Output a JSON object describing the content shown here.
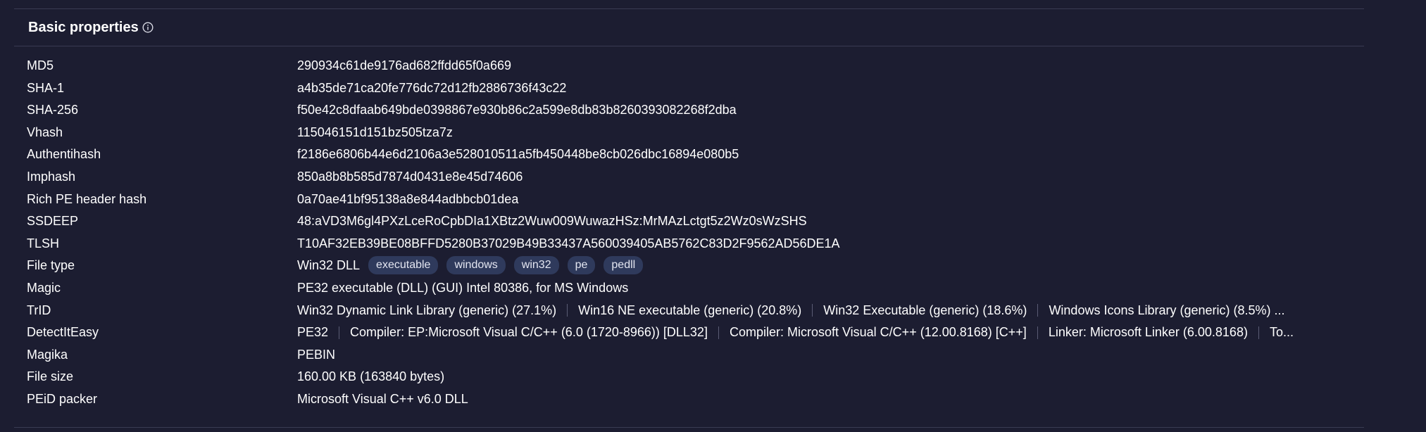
{
  "section": {
    "title": "Basic properties",
    "info_icon": "info-icon"
  },
  "properties": [
    {
      "label": "MD5",
      "value": "290934c61de9176ad682ffdd65f0a669"
    },
    {
      "label": "SHA-1",
      "value": "a4b35de71ca20fe776dc72d12fb2886736f43c22"
    },
    {
      "label": "SHA-256",
      "value": "f50e42c8dfaab649bde0398867e930b86c2a599e8db83b8260393082268f2dba"
    },
    {
      "label": "Vhash",
      "value": "115046151d151bz505tza7z"
    },
    {
      "label": "Authentihash",
      "value": "f2186e6806b44e6d2106a3e528010511a5fb450448be8cb026dbc16894e080b5"
    },
    {
      "label": "Imphash",
      "value": "850a8b8b585d7874d0431e8e45d74606"
    },
    {
      "label": "Rich PE header hash",
      "value": "0a70ae41bf95138a8e844adbbcb01dea"
    },
    {
      "label": "SSDEEP",
      "value": "48:aVD3M6gl4PXzLceRoCpbDIa1XBtz2Wuw009WuwazHSz:MrMAzLctgt5z2Wz0sWzSHS"
    },
    {
      "label": "TLSH",
      "value": "T10AF32EB39BE08BFFD5280B37029B49B33437A560039405AB5762C83D2F9562AD56DE1A"
    }
  ],
  "file_type": {
    "label": "File type",
    "value": "Win32 DLL",
    "tags": [
      "executable",
      "windows",
      "win32",
      "pe",
      "pedll"
    ]
  },
  "magic": {
    "label": "Magic",
    "value": "PE32 executable (DLL) (GUI) Intel 80386, for MS Windows"
  },
  "trid": {
    "label": "TrID",
    "items": [
      "Win32 Dynamic Link Library (generic) (27.1%)",
      "Win16 NE executable (generic) (20.8%)",
      "Win32 Executable (generic) (18.6%)",
      "Windows Icons Library (generic) (8.5%) ..."
    ]
  },
  "detectiteasy": {
    "label": "DetectItEasy",
    "items": [
      "PE32",
      "Compiler: EP:Microsoft Visual C/C++ (6.0 (1720-8966)) [DLL32]",
      "Compiler: Microsoft Visual C/C++ (12.00.8168) [C++]",
      "Linker: Microsoft Linker (6.00.8168)",
      "To..."
    ]
  },
  "tail_properties": [
    {
      "label": "Magika",
      "value": "PEBIN"
    },
    {
      "label": "File size",
      "value": "160.00 KB (163840 bytes)"
    },
    {
      "label": "PEiD packer",
      "value": "Microsoft Visual C++ v6.0 DLL"
    }
  ]
}
